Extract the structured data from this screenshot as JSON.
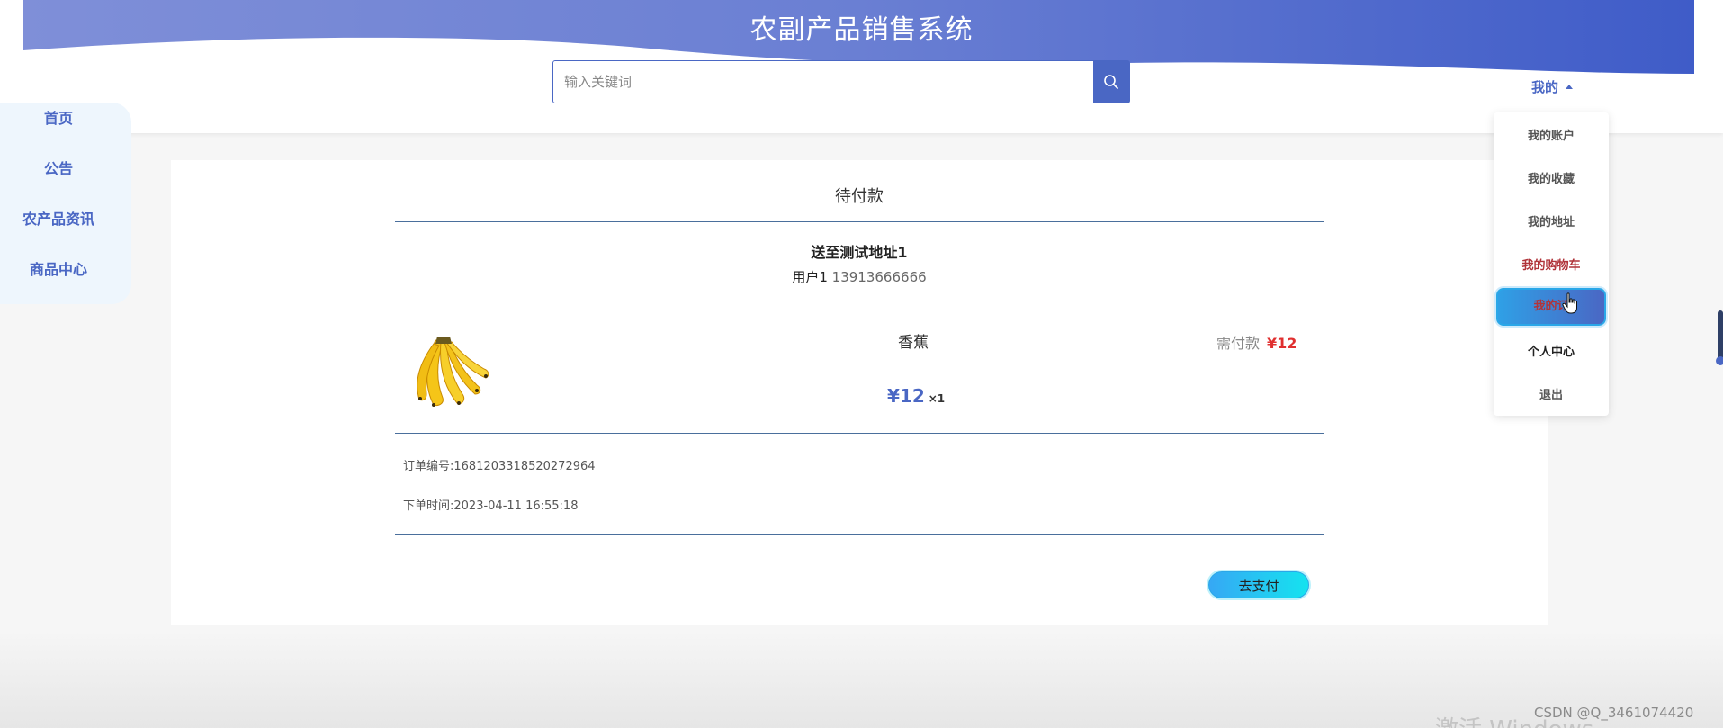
{
  "header": {
    "site_title": "农副产品销售系统",
    "search_placeholder": "输入关键词",
    "search_icon": "search-icon",
    "my_menu_label": "我的"
  },
  "side_nav": {
    "items": [
      {
        "label": "首页"
      },
      {
        "label": "公告"
      },
      {
        "label": "农产品资讯"
      },
      {
        "label": "商品中心"
      }
    ]
  },
  "dropdown": {
    "items": [
      {
        "label": "我的账户"
      },
      {
        "label": "我的收藏"
      },
      {
        "label": "我的地址"
      },
      {
        "label": "我的购物车"
      },
      {
        "label": "我的订"
      },
      {
        "label": "个人中心"
      },
      {
        "label": "退出"
      }
    ]
  },
  "order": {
    "status_title": "待付款",
    "address_title": "送至测试地址1",
    "user_name": "用户1",
    "user_phone": "13913666666",
    "product": {
      "name": "香蕉",
      "price": "¥12",
      "quantity": "×1",
      "image_icon": "banana-icon"
    },
    "need_pay_label": "需付款",
    "need_pay_amount": "¥12",
    "order_no_label": "订单编号:",
    "order_no": "1681203318520272964",
    "order_time_label": "下单时间:",
    "order_time": "2023-04-11 16:55:18",
    "pay_button_label": "去支付"
  },
  "watermarks": {
    "windows": "激活 Windows",
    "csdn": "CSDN @Q_3461074420"
  },
  "colors": {
    "primary": "#4a67c4",
    "price_red": "#e03030",
    "menu_red": "#b0343a",
    "pay_gradient_start": "#36a8f4",
    "pay_gradient_end": "#15e3ef"
  }
}
